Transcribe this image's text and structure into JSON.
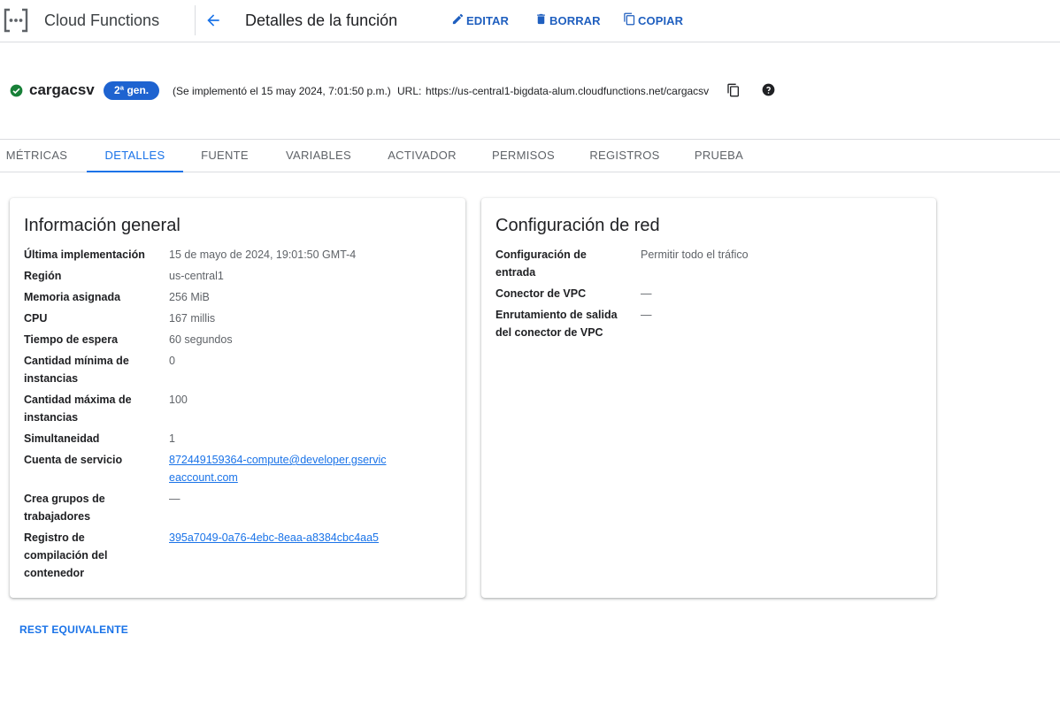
{
  "topbar": {
    "product_name": "Cloud Functions",
    "page_title": "Detalles de la función",
    "actions": {
      "edit": "EDITAR",
      "delete": "BORRAR",
      "copy": "COPIAR"
    },
    "accent_color": "#1a73e8"
  },
  "function": {
    "status_icon": "check-circle-icon",
    "status_color": "#188038",
    "name": "cargacsv",
    "generation": "2ª gen.",
    "deployed": "(Se implementó el 15 may 2024, 7:01:50 p.m.)",
    "url_label": "URL:",
    "url": "https://us-central1-bigdata-alum.cloudfunctions.net/cargacsv"
  },
  "tabs": [
    {
      "label": "MÉTRICAS",
      "active": false
    },
    {
      "label": "DETALLES",
      "active": true
    },
    {
      "label": "FUENTE",
      "active": false
    },
    {
      "label": "VARIABLES",
      "active": false
    },
    {
      "label": "ACTIVADOR",
      "active": false
    },
    {
      "label": "PERMISOS",
      "active": false
    },
    {
      "label": "REGISTROS",
      "active": false
    },
    {
      "label": "PRUEBA",
      "active": false
    }
  ],
  "general": {
    "title": "Información general",
    "rows": [
      {
        "key": "Última implementación",
        "value": "15 de mayo de 2024, 19:01:50 GMT-4"
      },
      {
        "key": "Región",
        "value": "us-central1"
      },
      {
        "key": "Memoria asignada",
        "value": "256 MiB"
      },
      {
        "key": "CPU",
        "value": "167 millis"
      },
      {
        "key": "Tiempo de espera",
        "value": "60 segundos"
      },
      {
        "key": "Cantidad mínima de instancias",
        "value": "0"
      },
      {
        "key": "Cantidad máxima de instancias",
        "value": "100"
      },
      {
        "key": "Simultaneidad",
        "value": "1"
      },
      {
        "key": "Cuenta de servicio",
        "value": "872449159364-compute@developer.gserviceaccount.com"
      },
      {
        "key": "Crea grupos de trabajadores",
        "value": "—"
      },
      {
        "key": "Registro de compilación del contenedor",
        "value": "395a7049-0a76-4ebc-8eaa-a8384cbc4aa5"
      }
    ]
  },
  "network": {
    "title": "Configuración de red",
    "rows": [
      {
        "key": "Configuración de entrada",
        "value": "Permitir todo el tráfico"
      },
      {
        "key": "Conector de VPC",
        "value": "—"
      },
      {
        "key": "Enrutamiento de salida del conector de VPC",
        "value": "—"
      }
    ]
  },
  "rest_link": "REST EQUIVALENTE"
}
